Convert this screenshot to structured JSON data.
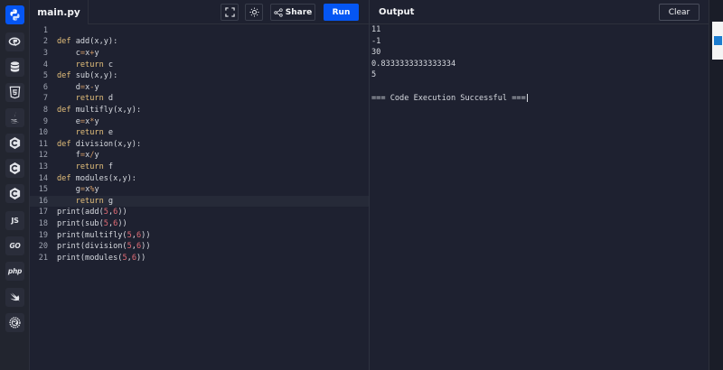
{
  "editor": {
    "file_name": "main.py",
    "share_label": "Share",
    "run_label": "Run",
    "lines": [
      {
        "n": "1",
        "segments": []
      },
      {
        "n": "2",
        "segments": [
          {
            "t": "def ",
            "c": "kw"
          },
          {
            "t": "add(x,y):",
            "c": ""
          }
        ]
      },
      {
        "n": "3",
        "segments": [
          {
            "t": "    c",
            "c": ""
          },
          {
            "t": "=",
            "c": "op"
          },
          {
            "t": "x",
            "c": ""
          },
          {
            "t": "+",
            "c": "op"
          },
          {
            "t": "y",
            "c": ""
          }
        ]
      },
      {
        "n": "4",
        "segments": [
          {
            "t": "    return ",
            "c": "kw"
          },
          {
            "t": "c",
            "c": ""
          }
        ]
      },
      {
        "n": "5",
        "segments": [
          {
            "t": "def ",
            "c": "kw"
          },
          {
            "t": "sub(x,y):",
            "c": ""
          }
        ]
      },
      {
        "n": "6",
        "segments": [
          {
            "t": "    d",
            "c": ""
          },
          {
            "t": "=",
            "c": "op"
          },
          {
            "t": "x",
            "c": ""
          },
          {
            "t": "-",
            "c": "op"
          },
          {
            "t": "y",
            "c": ""
          }
        ]
      },
      {
        "n": "7",
        "segments": [
          {
            "t": "    return ",
            "c": "kw"
          },
          {
            "t": "d",
            "c": ""
          }
        ]
      },
      {
        "n": "8",
        "segments": [
          {
            "t": "def ",
            "c": "kw"
          },
          {
            "t": "multifly(x,y):",
            "c": ""
          }
        ]
      },
      {
        "n": "9",
        "segments": [
          {
            "t": "    e",
            "c": ""
          },
          {
            "t": "=",
            "c": "op"
          },
          {
            "t": "x",
            "c": ""
          },
          {
            "t": "*",
            "c": "op"
          },
          {
            "t": "y",
            "c": ""
          }
        ]
      },
      {
        "n": "10",
        "segments": [
          {
            "t": "    return ",
            "c": "kw"
          },
          {
            "t": "e",
            "c": ""
          }
        ]
      },
      {
        "n": "11",
        "segments": [
          {
            "t": "def ",
            "c": "kw"
          },
          {
            "t": "division(x,y):",
            "c": ""
          }
        ]
      },
      {
        "n": "12",
        "segments": [
          {
            "t": "    f",
            "c": ""
          },
          {
            "t": "=",
            "c": "op"
          },
          {
            "t": "x",
            "c": ""
          },
          {
            "t": "/",
            "c": "op"
          },
          {
            "t": "y",
            "c": ""
          }
        ]
      },
      {
        "n": "13",
        "segments": [
          {
            "t": "    return ",
            "c": "kw"
          },
          {
            "t": "f",
            "c": ""
          }
        ]
      },
      {
        "n": "14",
        "segments": [
          {
            "t": "def ",
            "c": "kw"
          },
          {
            "t": "modules(x,y):",
            "c": ""
          }
        ]
      },
      {
        "n": "15",
        "segments": [
          {
            "t": "    g",
            "c": ""
          },
          {
            "t": "=",
            "c": "op"
          },
          {
            "t": "x",
            "c": ""
          },
          {
            "t": "%",
            "c": "op"
          },
          {
            "t": "y",
            "c": ""
          }
        ]
      },
      {
        "n": "16",
        "segments": [
          {
            "t": "    return ",
            "c": "kw"
          },
          {
            "t": "g",
            "c": ""
          }
        ]
      },
      {
        "n": "17",
        "segments": [
          {
            "t": "print(add(",
            "c": ""
          },
          {
            "t": "5",
            "c": "num"
          },
          {
            "t": ",",
            "c": ""
          },
          {
            "t": "6",
            "c": "num"
          },
          {
            "t": "))",
            "c": ""
          }
        ]
      },
      {
        "n": "18",
        "segments": [
          {
            "t": "print(sub(",
            "c": ""
          },
          {
            "t": "5",
            "c": "num"
          },
          {
            "t": ",",
            "c": ""
          },
          {
            "t": "6",
            "c": "num"
          },
          {
            "t": "))",
            "c": ""
          }
        ]
      },
      {
        "n": "19",
        "segments": [
          {
            "t": "print(multifly(",
            "c": ""
          },
          {
            "t": "5",
            "c": "num"
          },
          {
            "t": ",",
            "c": ""
          },
          {
            "t": "6",
            "c": "num"
          },
          {
            "t": "))",
            "c": ""
          }
        ]
      },
      {
        "n": "20",
        "segments": [
          {
            "t": "print(division(",
            "c": ""
          },
          {
            "t": "5",
            "c": "num"
          },
          {
            "t": ",",
            "c": ""
          },
          {
            "t": "6",
            "c": "num"
          },
          {
            "t": "))",
            "c": ""
          }
        ]
      },
      {
        "n": "21",
        "segments": [
          {
            "t": "print(modules(",
            "c": ""
          },
          {
            "t": "5",
            "c": "num"
          },
          {
            "t": ",",
            "c": ""
          },
          {
            "t": "6",
            "c": "num"
          },
          {
            "t": "))",
            "c": ""
          }
        ]
      }
    ],
    "highlighted_line": "16"
  },
  "output": {
    "title": "Output",
    "clear_label": "Clear",
    "lines": [
      "11",
      "-1",
      "30",
      "0.8333333333333334",
      "5",
      "",
      "=== Code Execution Successful ==="
    ]
  },
  "sidebar": {
    "languages": [
      {
        "name": "python-icon",
        "active": true
      },
      {
        "name": "r-icon"
      },
      {
        "name": "database-icon"
      },
      {
        "name": "html5-icon"
      },
      {
        "name": "java-icon"
      },
      {
        "name": "c-icon"
      },
      {
        "name": "cpp-icon"
      },
      {
        "name": "csharp-icon"
      },
      {
        "name": "javascript-icon",
        "label": "JS"
      },
      {
        "name": "go-icon",
        "label": "GO"
      },
      {
        "name": "php-icon",
        "label": "php"
      },
      {
        "name": "swift-icon"
      },
      {
        "name": "rust-icon"
      }
    ]
  },
  "colors": {
    "accent": "#0556f3",
    "background": "#1e2130",
    "keyword": "#e5c07b",
    "number": "#e06c75"
  }
}
